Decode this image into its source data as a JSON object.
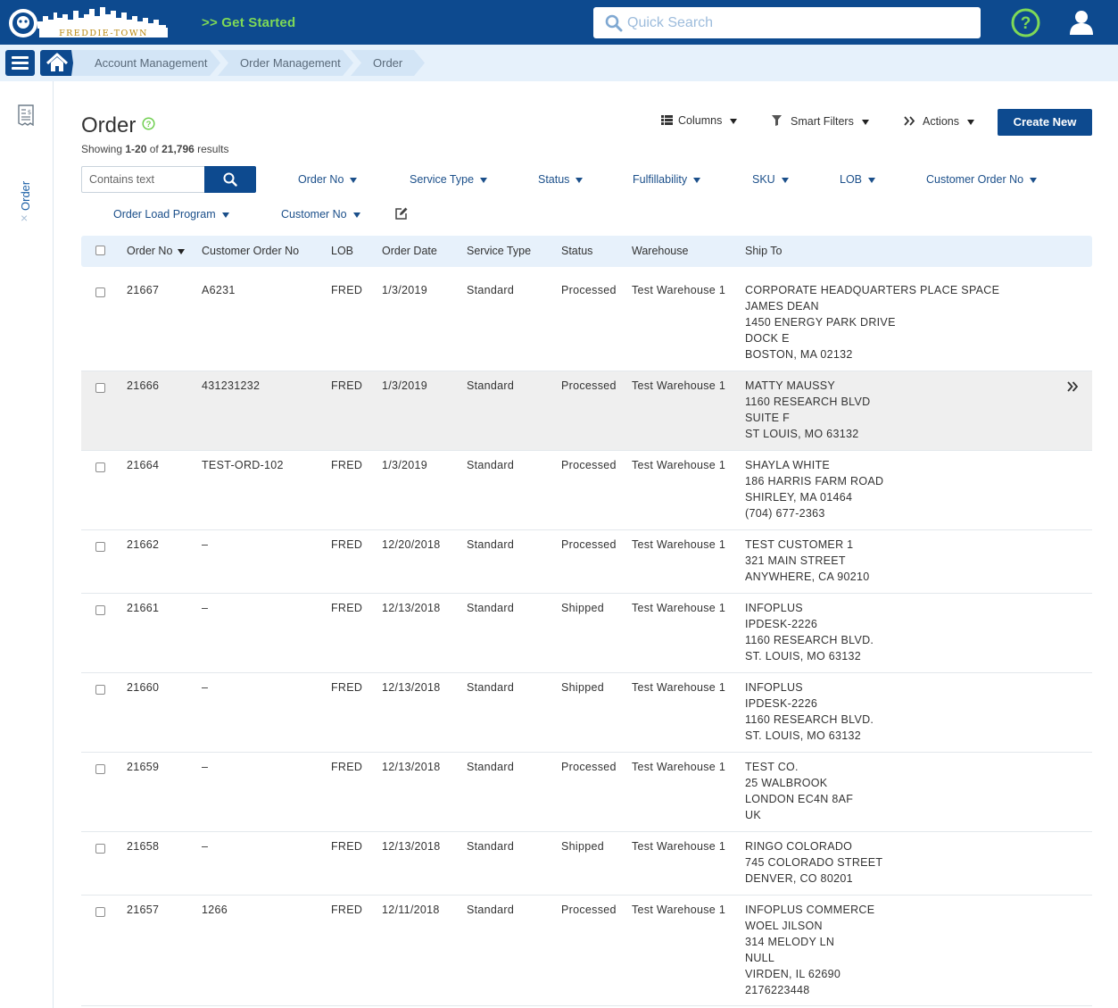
{
  "header": {
    "logo_text": "FREDDIE-TOWN",
    "get_started": ">> Get Started",
    "search_placeholder": "Quick Search"
  },
  "breadcrumb": [
    "Account Management",
    "Order Management",
    "Order"
  ],
  "side": {
    "label": "Order",
    "close": "×"
  },
  "page": {
    "title": "Order",
    "results_prefix": "Showing ",
    "results_range": "1-20",
    "results_mid": " of ",
    "results_total": "21,796",
    "results_suffix": " results"
  },
  "toolbar": {
    "columns": "Columns",
    "smart_filters": "Smart Filters",
    "actions": "Actions",
    "create_new": "Create New"
  },
  "filter": {
    "placeholder": "Contains text",
    "chips": [
      "Order No",
      "Service Type",
      "Status",
      "Fulfillability",
      "SKU",
      "LOB",
      "Customer Order No",
      "Order Load Program",
      "Customer No"
    ]
  },
  "table": {
    "headers": [
      "Order No",
      "Customer Order No",
      "LOB",
      "Order Date",
      "Service Type",
      "Status",
      "Warehouse",
      "Ship To"
    ],
    "rows": [
      {
        "order_no": "21667",
        "customer_order_no": "A6231",
        "lob": "FRED",
        "order_date": "1/3/2019",
        "service_type": "Standard",
        "status": "Processed",
        "warehouse": "Test Warehouse 1",
        "ship_to": [
          "CORPORATE HEADQUARTERS PLACE SPACE",
          "JAMES DEAN",
          "1450 ENERGY PARK DRIVE",
          "DOCK E",
          "BOSTON, MA 02132"
        ]
      },
      {
        "order_no": "21666",
        "customer_order_no": "431231232",
        "lob": "FRED",
        "order_date": "1/3/2019",
        "service_type": "Standard",
        "status": "Processed",
        "warehouse": "Test Warehouse 1",
        "ship_to": [
          "MATTY MAUSSY",
          "1160 RESEARCH BLVD",
          "SUITE F",
          "ST LOUIS, MO 63132"
        ]
      },
      {
        "order_no": "21664",
        "customer_order_no": "TEST-ORD-102",
        "lob": "FRED",
        "order_date": "1/3/2019",
        "service_type": "Standard",
        "status": "Processed",
        "warehouse": "Test Warehouse 1",
        "ship_to": [
          "SHAYLA WHITE",
          "186 HARRIS FARM ROAD",
          "SHIRLEY, MA 01464",
          "(704) 677-2363"
        ]
      },
      {
        "order_no": "21662",
        "customer_order_no": "–",
        "lob": "FRED",
        "order_date": "12/20/2018",
        "service_type": "Standard",
        "status": "Processed",
        "warehouse": "Test Warehouse 1",
        "ship_to": [
          "TEST CUSTOMER 1",
          "321 MAIN STREET",
          "ANYWHERE, CA 90210"
        ]
      },
      {
        "order_no": "21661",
        "customer_order_no": "–",
        "lob": "FRED",
        "order_date": "12/13/2018",
        "service_type": "Standard",
        "status": "Shipped",
        "warehouse": "Test Warehouse 1",
        "ship_to": [
          "INFOPLUS",
          "IPDESK-2226",
          "1160 RESEARCH BLVD.",
          "ST. LOUIS, MO 63132"
        ]
      },
      {
        "order_no": "21660",
        "customer_order_no": "–",
        "lob": "FRED",
        "order_date": "12/13/2018",
        "service_type": "Standard",
        "status": "Shipped",
        "warehouse": "Test Warehouse 1",
        "ship_to": [
          "INFOPLUS",
          "IPDESK-2226",
          "1160 RESEARCH BLVD.",
          "ST. LOUIS, MO 63132"
        ]
      },
      {
        "order_no": "21659",
        "customer_order_no": "–",
        "lob": "FRED",
        "order_date": "12/13/2018",
        "service_type": "Standard",
        "status": "Processed",
        "warehouse": "Test Warehouse 1",
        "ship_to": [
          "TEST CO.",
          "25 WALBROOK",
          "LONDON EC4N 8AF",
          "UK"
        ]
      },
      {
        "order_no": "21658",
        "customer_order_no": "–",
        "lob": "FRED",
        "order_date": "12/13/2018",
        "service_type": "Standard",
        "status": "Shipped",
        "warehouse": "Test Warehouse 1",
        "ship_to": [
          "RINGO COLORADO",
          "745 COLORADO STREET",
          "DENVER, CO 80201"
        ]
      },
      {
        "order_no": "21657",
        "customer_order_no": "1266",
        "lob": "FRED",
        "order_date": "12/11/2018",
        "service_type": "Standard",
        "status": "Processed",
        "warehouse": "Test Warehouse 1",
        "ship_to": [
          "INFOPLUS COMMERCE",
          "WOEL JILSON",
          "314 MELODY LN",
          "NULL",
          "VIRDEN, IL 62690",
          "2176223448"
        ]
      }
    ]
  }
}
